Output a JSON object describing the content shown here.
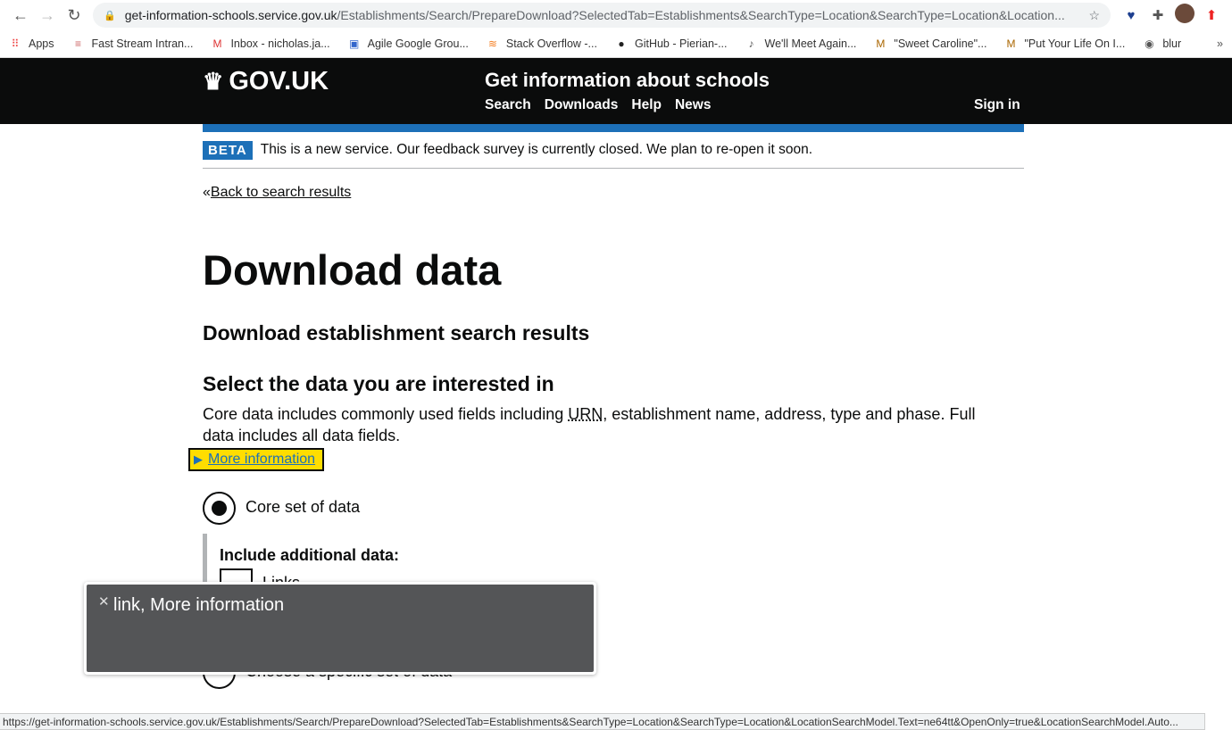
{
  "browser": {
    "url_host": "get-information-schools.service.gov.uk",
    "url_path": "/Establishments/Search/PrepareDownload?SelectedTab=Establishments&SearchType=Location&SearchType=Location&Location...",
    "bookmarks": [
      {
        "label": "Apps",
        "icon": "apps-grid-icon"
      },
      {
        "label": "Fast Stream Intran...",
        "icon": "fast-stream-icon"
      },
      {
        "label": "Inbox - nicholas.ja...",
        "icon": "gmail-icon"
      },
      {
        "label": "Agile Google Grou...",
        "icon": "google-groups-icon"
      },
      {
        "label": "Stack Overflow -...",
        "icon": "stack-overflow-icon"
      },
      {
        "label": "GitHub - Pierian-...",
        "icon": "github-icon"
      },
      {
        "label": "We'll Meet Again...",
        "icon": "harp-icon"
      },
      {
        "label": "\"Sweet Caroline\"...",
        "icon": "m-icon"
      },
      {
        "label": "\"Put Your Life On I...",
        "icon": "m-icon"
      },
      {
        "label": "blur",
        "icon": "globe-icon"
      }
    ],
    "more": "»",
    "status_url": "https://get-information-schools.service.gov.uk/Establishments/Search/PrepareDownload?SelectedTab=Establishments&SearchType=Location&SearchType=Location&LocationSearchModel.Text=ne64tt&OpenOnly=true&LocationSearchModel.Auto..."
  },
  "header": {
    "logo": "GOV.UK",
    "service": "Get information about schools",
    "nav": [
      "Search",
      "Downloads",
      "Help",
      "News"
    ],
    "sign_in": "Sign in"
  },
  "beta": {
    "tag": "BETA",
    "text": "This is a new service. Our feedback survey is currently closed. We plan to re-open it soon."
  },
  "back": {
    "prefix": "«",
    "label": "Back to search results"
  },
  "page": {
    "title": "Download data",
    "subtitle": "Download establishment search results",
    "section": "Select the data you are interested in",
    "body_pre": "Core data includes commonly used fields including ",
    "body_abbr": "URN",
    "body_post": ", establishment name, address, type and phase. Full data includes all data fields.",
    "details": "More information",
    "option_core": "Core set of data",
    "additional": "Include additional data:",
    "links": "Links",
    "option_specific": "Choose a specific set of data"
  },
  "voiceover": {
    "text": "link, More information"
  },
  "colors": {
    "blue": "#1d70b8",
    "focus": "#ffdd00",
    "header": "#0b0c0c"
  }
}
